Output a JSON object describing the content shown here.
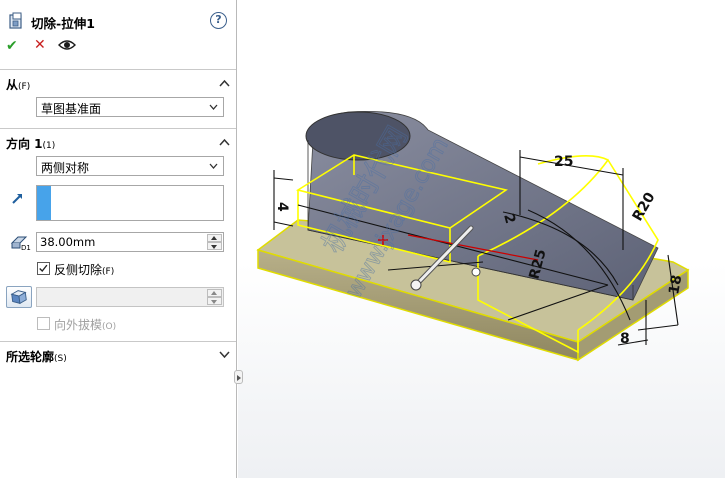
{
  "feature": {
    "icon": "cut-extrude-icon",
    "title": "切除-拉伸1",
    "help": "?"
  },
  "actions": {
    "ok": "✔",
    "cancel": "✕",
    "preview": "eye-icon"
  },
  "from": {
    "title": "从",
    "shortcut": "(F)",
    "value": "草图基准面"
  },
  "direction1": {
    "title": "方向 1",
    "shortcut": "(1)",
    "end_condition": "两侧对称",
    "depth": "38.00mm",
    "flip_side_label": "反侧切除",
    "flip_side_shortcut": "(F)",
    "flip_side_checked": true,
    "draft_value": "",
    "draft_outward_label": "向外拔模",
    "draft_outward_shortcut": "(O)",
    "draft_outward_checked": false
  },
  "selected_contours": {
    "title": "所选轮廓",
    "shortcut": "(S)"
  },
  "dimensions": {
    "d25_top": "25",
    "r20": "R20",
    "d2": "2",
    "d4": "4",
    "r25": "R25",
    "d18": "18",
    "d8": "8"
  },
  "watermark": {
    "line1": "机械时代网",
    "line2": "www.jxage.com"
  },
  "colors": {
    "accent": "#47a3ea",
    "selection": "#ffff00",
    "ok": "#2a9e2a",
    "cancel": "#c81e1e",
    "part": "#6e7388"
  }
}
